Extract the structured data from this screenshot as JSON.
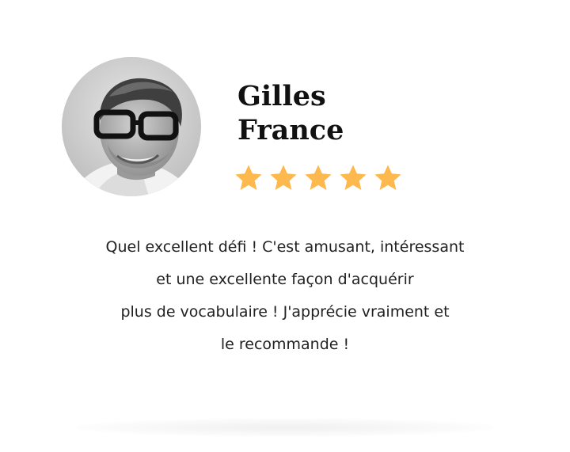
{
  "testimonial": {
    "name_line1": "Gilles",
    "name_line2": "France",
    "rating": 5,
    "rating_max": 5,
    "star_color": "#FDB94E",
    "quote_lines": [
      "Quel excellent défi ! C'est amusant, intéressant",
      "et une excellente façon d'acquérir",
      "plus de vocabulaire ! J'apprécie vraiment et",
      "le recommande !"
    ]
  }
}
